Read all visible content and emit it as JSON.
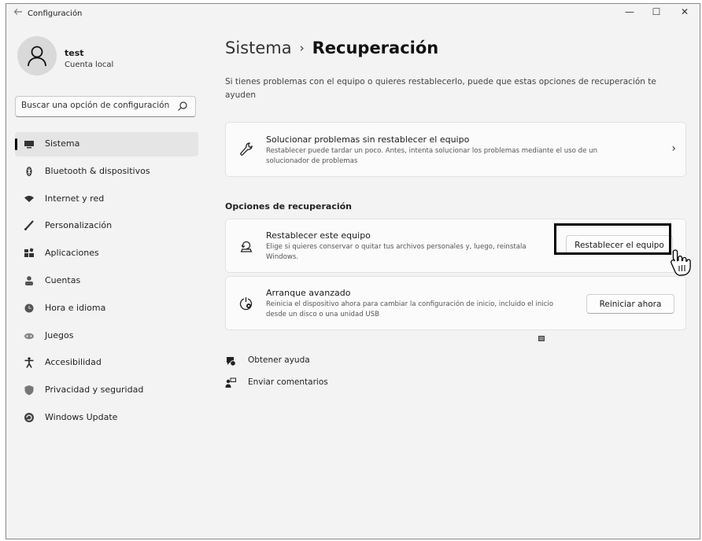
{
  "window": {
    "title": "Configuración",
    "back_icon": "arrow-left-icon",
    "minimize_glyph": "—",
    "maximize_glyph": "☐",
    "close_glyph": "✕"
  },
  "user": {
    "name": "test",
    "account_type": "Cuenta local"
  },
  "search": {
    "placeholder": "Buscar una opción de configuración"
  },
  "sidebar": {
    "items": [
      {
        "label": "Sistema",
        "icon": "monitor-icon",
        "active": true
      },
      {
        "label": "Bluetooth & dispositivos",
        "icon": "bluetooth-icon"
      },
      {
        "label": "Internet y red",
        "icon": "wifi-icon"
      },
      {
        "label": "Personalización",
        "icon": "brush-icon"
      },
      {
        "label": "Aplicaciones",
        "icon": "apps-icon"
      },
      {
        "label": "Cuentas",
        "icon": "person-icon"
      },
      {
        "label": "Hora e idioma",
        "icon": "globe-clock-icon"
      },
      {
        "label": "Juegos",
        "icon": "gamepad-icon"
      },
      {
        "label": "Accesibilidad",
        "icon": "accessibility-icon"
      },
      {
        "label": "Privacidad y seguridad",
        "icon": "shield-icon"
      },
      {
        "label": "Windows Update",
        "icon": "update-icon"
      }
    ]
  },
  "main": {
    "breadcrumb": {
      "parent": "Sistema",
      "separator": "›",
      "current": "Recuperación"
    },
    "description": "Si tienes problemas con el equipo o quieres restablecerlo, puede que estas opciones de recuperación te ayuden",
    "troubleshoot_card": {
      "title": "Solucionar problemas sin restablecer el equipo",
      "description": "Restablecer puede tardar un poco. Antes, intenta solucionar los problemas mediante el uso de un solucionador de problemas",
      "icon": "wrench-icon"
    },
    "section_title": "Opciones de recuperación",
    "reset_card": {
      "title": "Restablecer este equipo",
      "description": "Elige si quieres conservar o quitar tus archivos personales y, luego, reinstala Windows.",
      "button": "Restablecer el equipo",
      "icon": "reset-pc-icon"
    },
    "advanced_card": {
      "title": "Arranque avanzado",
      "description": "Reinicia el dispositivo ahora para cambiar la configuración de inicio, incluido el inicio desde un disco o una unidad USB",
      "button": "Reiniciar ahora",
      "icon": "advanced-startup-icon"
    },
    "help": {
      "get_help": "Obtener ayuda",
      "feedback": "Enviar comentarios"
    }
  }
}
